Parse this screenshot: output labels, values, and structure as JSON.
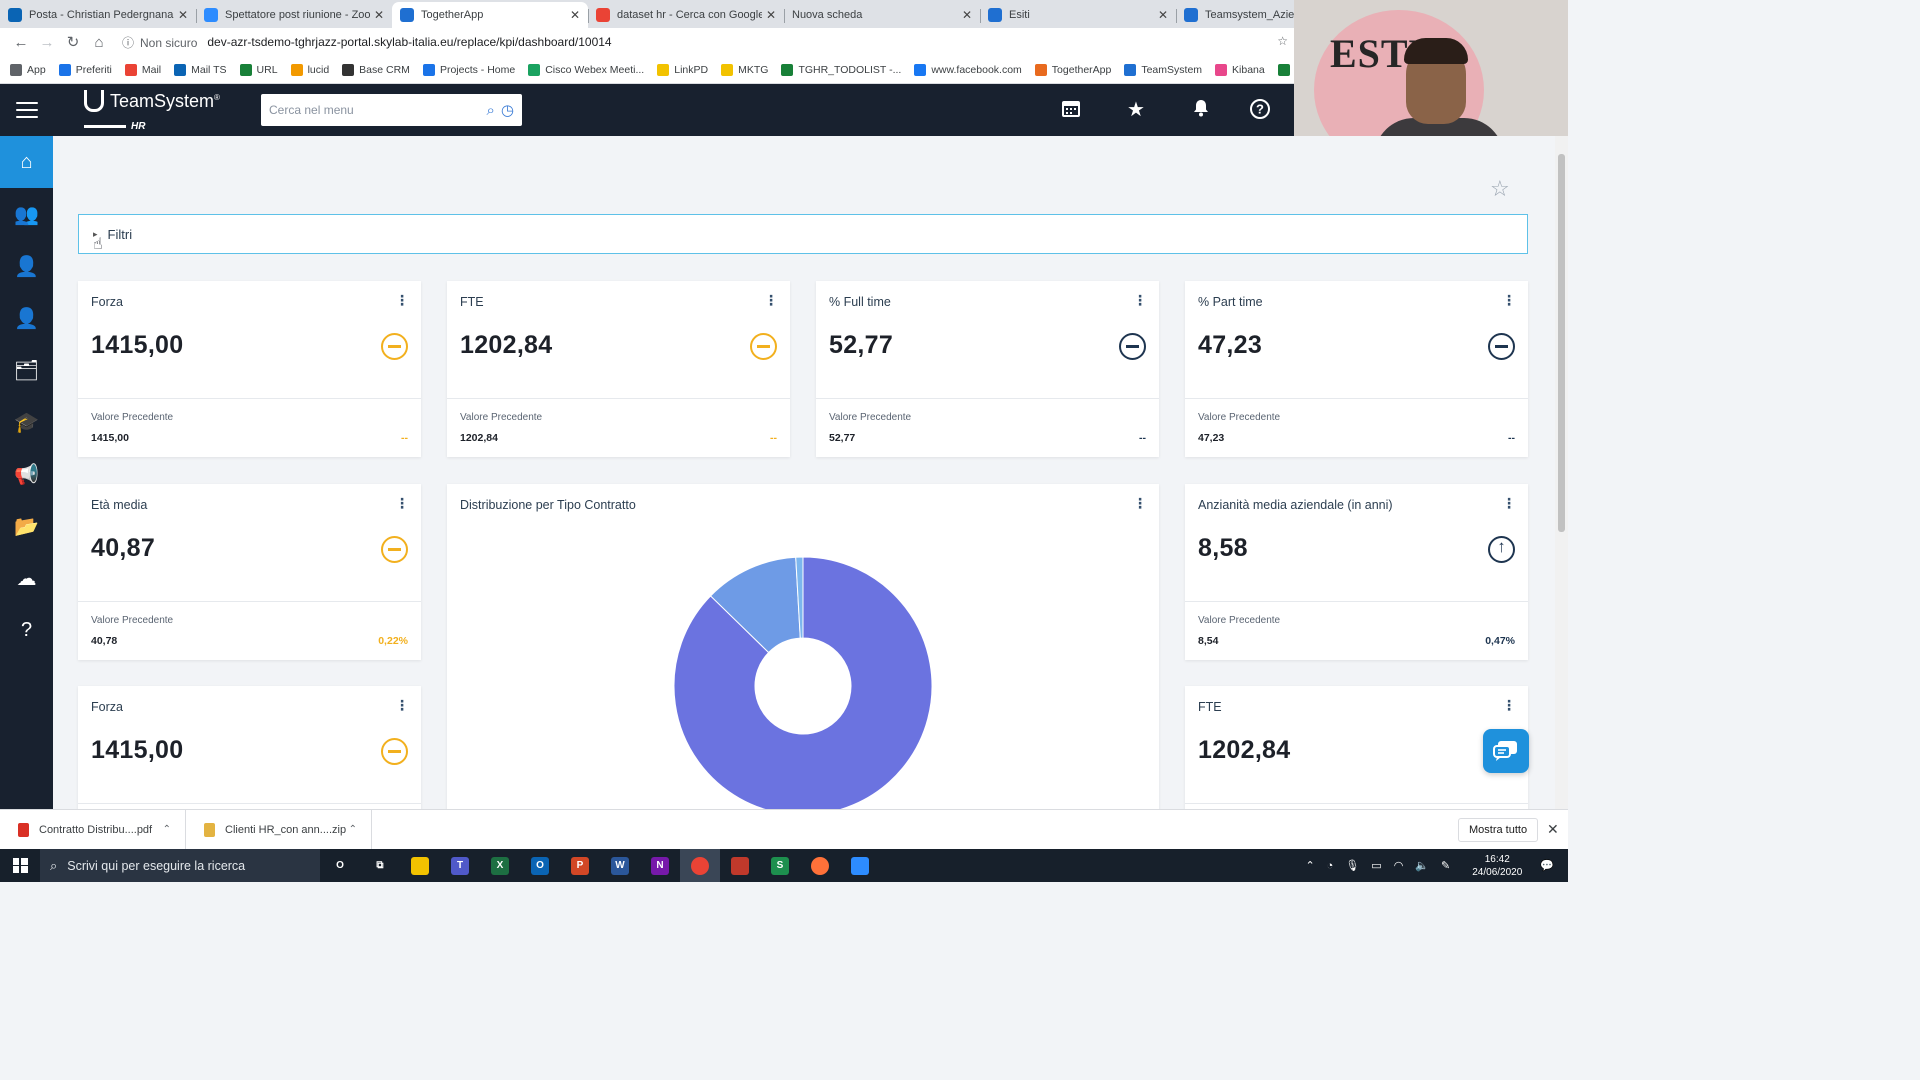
{
  "browser": {
    "tabs": [
      {
        "title": "Posta - Christian Pedergnana - O",
        "color": "#0a64b4",
        "active": false
      },
      {
        "title": "Spettatore post riunione - Zoom",
        "color": "#2d8cff",
        "active": false
      },
      {
        "title": "TogetherApp",
        "color": "#1f6fd1",
        "active": true
      },
      {
        "title": "dataset hr - Cerca con Google",
        "color": "#ea4335",
        "active": false
      },
      {
        "title": "Nuova scheda",
        "color": "#ffffff",
        "active": false
      },
      {
        "title": "Esiti",
        "color": "#1f6fd1",
        "active": false
      },
      {
        "title": "Teamsystem_Azienda",
        "color": "#1f6fd1",
        "active": false
      }
    ],
    "security": "Non sicuro",
    "url": "dev-azr-tsdemo-tghrjazz-portal.skylab-italia.eu/replace/kpi/dashboard/10014",
    "bookmarks": [
      {
        "label": "App",
        "color": "#5f6368"
      },
      {
        "label": "Preferiti",
        "color": "#1a73e8"
      },
      {
        "label": "Mail",
        "color": "#ea4335"
      },
      {
        "label": "Mail TS",
        "color": "#0a64b4"
      },
      {
        "label": "URL",
        "color": "#188038"
      },
      {
        "label": "lucid",
        "color": "#f29900"
      },
      {
        "label": "Base CRM",
        "color": "#333333"
      },
      {
        "label": "Projects - Home",
        "color": "#1a73e8"
      },
      {
        "label": "Cisco Webex Meeti...",
        "color": "#1aa260"
      },
      {
        "label": "LinkPD",
        "color": "#f2c200"
      },
      {
        "label": "MKTG",
        "color": "#f2c200"
      },
      {
        "label": "TGHR_TODOLIST -...",
        "color": "#188038"
      },
      {
        "label": "www.facebook.com",
        "color": "#1877f2"
      },
      {
        "label": "TogetherApp",
        "color": "#e86a1f"
      },
      {
        "label": "TeamSystem",
        "color": "#1f6fd1"
      },
      {
        "label": "Kibana",
        "color": "#e8478b"
      },
      {
        "label": "http",
        "color": "#188038"
      }
    ]
  },
  "header": {
    "brand": "TeamSystem",
    "brand_mark": "®",
    "product": "HR",
    "search_placeholder": "Cerca nel menu",
    "icons": [
      "calendar-icon",
      "star-icon",
      "bell-icon",
      "help-icon"
    ]
  },
  "webcam": {
    "sign_text": "ESTE"
  },
  "sidebar": {
    "items": [
      {
        "icon": "home-icon",
        "glyph": "⌂",
        "active": true
      },
      {
        "icon": "group-icon",
        "glyph": "👥",
        "active": false
      },
      {
        "icon": "user-settings-icon",
        "glyph": "👤",
        "active": false
      },
      {
        "icon": "user-manage-icon",
        "glyph": "👤",
        "active": false
      },
      {
        "icon": "presentation-icon",
        "glyph": "🗂",
        "active": false
      },
      {
        "icon": "graduation-icon",
        "glyph": "🎓",
        "active": false
      },
      {
        "icon": "megaphone-icon",
        "glyph": "📢",
        "active": false
      },
      {
        "icon": "folder-icon",
        "glyph": "📂",
        "active": false
      },
      {
        "icon": "cloud-upload-icon",
        "glyph": "☁",
        "active": false
      },
      {
        "icon": "help-icon",
        "glyph": "?",
        "active": false
      }
    ]
  },
  "filters": {
    "label": "Filtri"
  },
  "kpis": {
    "forza": {
      "title": "Forza",
      "value": "1415,00",
      "prev_label": "Valore Precedente",
      "prev_value": "1415,00",
      "delta": "--",
      "trend": "equal",
      "color": "amber"
    },
    "fte": {
      "title": "FTE",
      "value": "1202,84",
      "prev_label": "Valore Precedente",
      "prev_value": "1202,84",
      "delta": "--",
      "trend": "equal",
      "color": "amber"
    },
    "full_time": {
      "title": "% Full time",
      "value": "52,77",
      "prev_label": "Valore Precedente",
      "prev_value": "52,77",
      "delta": "--",
      "trend": "equal",
      "color": "navy"
    },
    "part_time": {
      "title": "% Part time",
      "value": "47,23",
      "prev_label": "Valore Precedente",
      "prev_value": "47,23",
      "delta": "--",
      "trend": "equal",
      "color": "navy"
    },
    "eta_media": {
      "title": "Età media",
      "value": "40,87",
      "prev_label": "Valore Precedente",
      "prev_value": "40,78",
      "delta": "0,22%",
      "trend": "equal",
      "color": "amber"
    },
    "anzianita": {
      "title": "Anzianità media aziendale (in anni)",
      "value": "8,58",
      "prev_label": "Valore Precedente",
      "prev_value": "8,54",
      "delta": "0,47%",
      "trend": "up",
      "color": "navy"
    },
    "forza2": {
      "title": "Forza",
      "value": "1415,00",
      "trend": "equal",
      "color": "amber"
    },
    "fte2": {
      "title": "FTE",
      "value": "1202,84"
    }
  },
  "chart_data": {
    "type": "pie",
    "title": "Distribuzione per Tipo Contratto",
    "donut": true,
    "values": [
      87.3,
      11.8,
      0.9
    ],
    "colors": [
      "#6b73e0",
      "#6e9be6",
      "#7cb6ee"
    ],
    "legend": false
  },
  "downloads": {
    "items": [
      {
        "name": "Contratto Distribu....pdf",
        "color": "#d93025"
      },
      {
        "name": "Clienti HR_con ann....zip",
        "color": "#e3b341"
      }
    ],
    "show_all": "Mostra tutto"
  },
  "taskbar": {
    "search_placeholder": "Scrivi qui per eseguire la ricerca",
    "apps": [
      {
        "icon": "cortana-icon",
        "label": "O",
        "color": "transparent"
      },
      {
        "icon": "task-view-icon",
        "label": "⧉",
        "color": "transparent"
      },
      {
        "icon": "file-explorer-icon",
        "label": "",
        "color": "#f2c200"
      },
      {
        "icon": "teams-icon",
        "label": "T",
        "color": "#5059c9"
      },
      {
        "icon": "excel-icon",
        "label": "X",
        "color": "#1d6f42"
      },
      {
        "icon": "outlook-icon",
        "label": "O",
        "color": "#0a64b4"
      },
      {
        "icon": "powerpoint-icon",
        "label": "P",
        "color": "#d24726"
      },
      {
        "icon": "word-icon",
        "label": "W",
        "color": "#2b579a"
      },
      {
        "icon": "onenote-icon",
        "label": "N",
        "color": "#7719aa"
      },
      {
        "icon": "chrome-icon",
        "label": "",
        "color": "#ea4335"
      },
      {
        "icon": "app-red-icon",
        "label": "",
        "color": "#c0392b"
      },
      {
        "icon": "s-app-icon",
        "label": "S",
        "color": "#1d8f4e"
      },
      {
        "icon": "firefox-icon",
        "label": "",
        "color": "#ff7139"
      },
      {
        "icon": "zoom-icon",
        "label": "",
        "color": "#2d8cff"
      }
    ],
    "time": "16:42",
    "date": "24/06/2020"
  }
}
